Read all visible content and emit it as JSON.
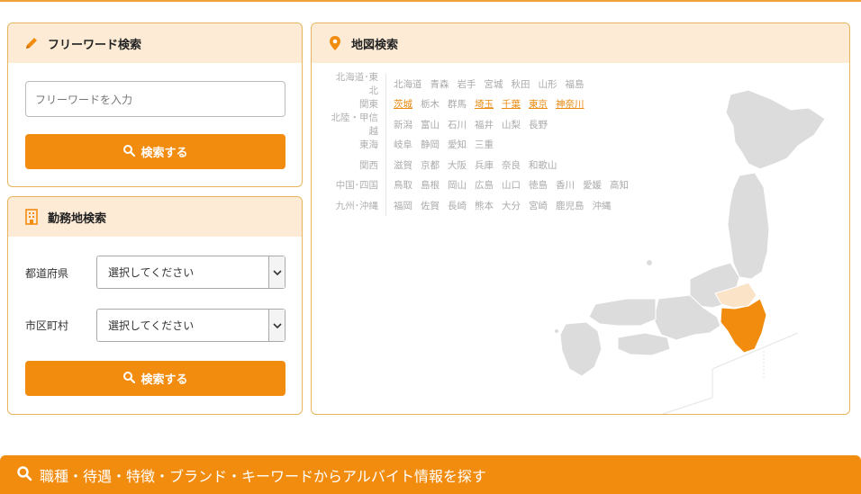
{
  "freeword": {
    "title": "フリーワード検索",
    "placeholder": "フリーワードを入力",
    "search_button": "検索する",
    "icon": "pencil-icon"
  },
  "workplace": {
    "title": "勤務地検索",
    "icon": "building-icon",
    "prefecture_label": "都道府県",
    "prefecture_value": "選択してください",
    "city_label": "市区町村",
    "city_value": "選択してください",
    "search_button": "検索する"
  },
  "map_search": {
    "title": "地図検索",
    "icon": "map-pin-icon",
    "regions": [
      {
        "name": "北海道･東北",
        "prefs": [
          {
            "label": "北海道"
          },
          {
            "label": "青森"
          },
          {
            "label": "岩手"
          },
          {
            "label": "宮城"
          },
          {
            "label": "秋田"
          },
          {
            "label": "山形"
          },
          {
            "label": "福島"
          }
        ]
      },
      {
        "name": "関東",
        "prefs": [
          {
            "label": "茨城",
            "active": true
          },
          {
            "label": "栃木"
          },
          {
            "label": "群馬"
          },
          {
            "label": "埼玉",
            "active": true
          },
          {
            "label": "千葉",
            "active": true
          },
          {
            "label": "東京",
            "active": true
          },
          {
            "label": "神奈川",
            "active": true
          }
        ]
      },
      {
        "name": "北陸・甲信越",
        "prefs": [
          {
            "label": "新潟"
          },
          {
            "label": "富山"
          },
          {
            "label": "石川"
          },
          {
            "label": "福井"
          },
          {
            "label": "山梨"
          },
          {
            "label": "長野"
          }
        ]
      },
      {
        "name": "東海",
        "prefs": [
          {
            "label": "岐阜"
          },
          {
            "label": "静岡"
          },
          {
            "label": "愛知"
          },
          {
            "label": "三重"
          }
        ]
      },
      {
        "name": "関西",
        "prefs": [
          {
            "label": "滋賀"
          },
          {
            "label": "京都"
          },
          {
            "label": "大阪"
          },
          {
            "label": "兵庫"
          },
          {
            "label": "奈良"
          },
          {
            "label": "和歌山"
          }
        ]
      },
      {
        "name": "中国･四国",
        "prefs": [
          {
            "label": "鳥取"
          },
          {
            "label": "島根"
          },
          {
            "label": "岡山"
          },
          {
            "label": "広島"
          },
          {
            "label": "山口"
          },
          {
            "label": "徳島"
          },
          {
            "label": "香川"
          },
          {
            "label": "愛媛"
          },
          {
            "label": "高知"
          }
        ]
      },
      {
        "name": "九州･沖縄",
        "prefs": [
          {
            "label": "福岡"
          },
          {
            "label": "佐賀"
          },
          {
            "label": "長崎"
          },
          {
            "label": "熊本"
          },
          {
            "label": "大分"
          },
          {
            "label": "宮崎"
          },
          {
            "label": "鹿児島"
          },
          {
            "label": "沖縄"
          }
        ]
      }
    ]
  },
  "bottom_bar": {
    "text": "職種・待遇・特徴・ブランド・キーワードからアルバイト情報を探す",
    "icon": "search-icon"
  },
  "colors": {
    "accent": "#f28c0f",
    "panel_header": "#fdebd6",
    "active_pref": "#e98a12",
    "map_inactive": "#dcdcdc",
    "map_highlight": "#f28c0f",
    "map_light": "#fbe3c8"
  }
}
